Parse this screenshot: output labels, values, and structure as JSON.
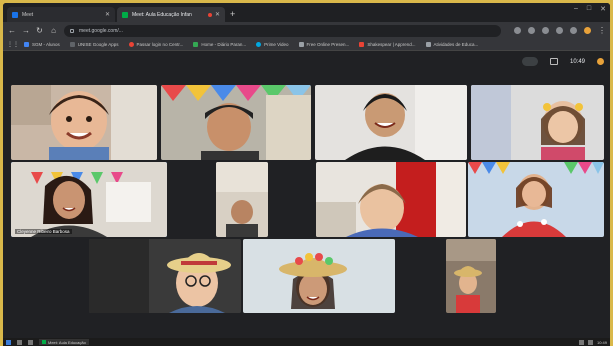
{
  "tabs": [
    {
      "label": "Meet",
      "active": false,
      "favicon_color": "#1a73e8"
    },
    {
      "label": "Meet: Aula Educação Infan",
      "active": true,
      "favicon_color": "#00ac47"
    }
  ],
  "address": {
    "url": "meet.google.com/..."
  },
  "bookmarks": [
    {
      "label": "SGM - Alunos",
      "color": "#4285f4"
    },
    {
      "label": "UNISE Google Apps",
      "color": "#5f6368"
    },
    {
      "label": "Passar login no Centr...",
      "color": "#ea4335"
    },
    {
      "label": "Home - Diário Paran...",
      "color": "#34a853"
    },
    {
      "label": "Prime Video",
      "color": "#00a8e1"
    },
    {
      "label": "Free Online Presen...",
      "color": "#9aa0a6"
    },
    {
      "label": "Shakespear | Apprend...",
      "color": "#ea4335"
    },
    {
      "label": "Atividades de Educa...",
      "color": "#9aa0a6"
    }
  ],
  "meet": {
    "time": "10:49"
  },
  "participants": [
    {
      "label": "",
      "speaking": false
    },
    {
      "label": "",
      "speaking": false
    },
    {
      "label": "",
      "speaking": false
    },
    {
      "label": "",
      "speaking": false
    },
    {
      "label": "Cleyenne Ribeiro Barbosa",
      "speaking": true
    },
    {
      "label": "",
      "speaking": false
    },
    {
      "label": "",
      "speaking": false
    },
    {
      "label": "",
      "speaking": false
    },
    {
      "label": "",
      "speaking": false
    },
    {
      "label": "",
      "speaking": false
    },
    {
      "label": "",
      "speaking": false
    }
  ],
  "taskbar": {
    "app": "Meet: Aula Educação",
    "clock": "10:49"
  },
  "colors": {
    "accent": "#1a73e8",
    "background": "#202124",
    "border": "#d9b84a"
  }
}
